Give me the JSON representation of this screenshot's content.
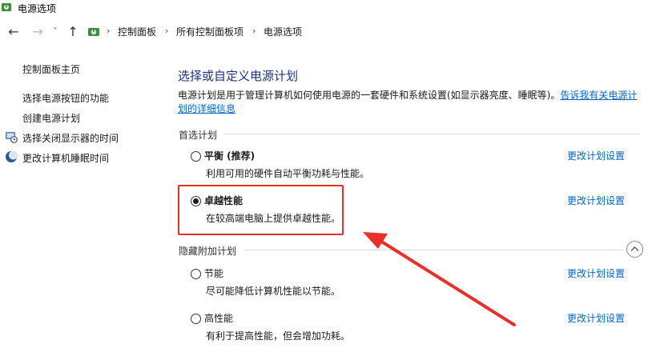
{
  "window": {
    "title": "电源选项"
  },
  "navbar": {
    "back_icon": "←",
    "forward_icon": "→",
    "recent_icon": "˅",
    "up_icon": "↑",
    "breadcrumbs": [
      "控制面板",
      "所有控制面板项",
      "电源选项"
    ],
    "separator": "›"
  },
  "sidebar": {
    "home": "控制面板主页",
    "links": [
      {
        "label": "选择电源按钮的功能",
        "icon": ""
      },
      {
        "label": "创建电源计划",
        "icon": ""
      },
      {
        "label": "选择关闭显示器的时间",
        "icon": "monitor-clock-icon"
      },
      {
        "label": "更改计算机睡眠时间",
        "icon": "moon-icon"
      }
    ]
  },
  "main": {
    "title": "选择或自定义电源计划",
    "description": "电源计划是用于管理计算机如何使用电源的一套硬件和系统设置(如显示器亮度、睡眠等)。",
    "description_link": "告诉我有关电源计划的详细信息",
    "preferred_label": "首选计划",
    "hidden_label": "隐藏附加计划",
    "plans": [
      {
        "name": "平衡 (推荐)",
        "desc": "利用可用的硬件自动平衡功耗与性能。",
        "link": "更改计划设置",
        "checked": false
      },
      {
        "name": "卓越性能",
        "desc": "在较高端电脑上提供卓越性能。",
        "link": "更改计划设置",
        "checked": true
      },
      {
        "name": "节能",
        "desc": "尽可能降低计算机性能以节能。",
        "link": "更改计划设置",
        "checked": false
      },
      {
        "name": "高性能",
        "desc": "有利于提高性能，但会增加功耗。",
        "link": "更改计划设置",
        "checked": false
      }
    ]
  },
  "colors": {
    "title_blue": "#1e3287",
    "link_blue": "#0066cc",
    "annotation_red": "#e8302a"
  }
}
